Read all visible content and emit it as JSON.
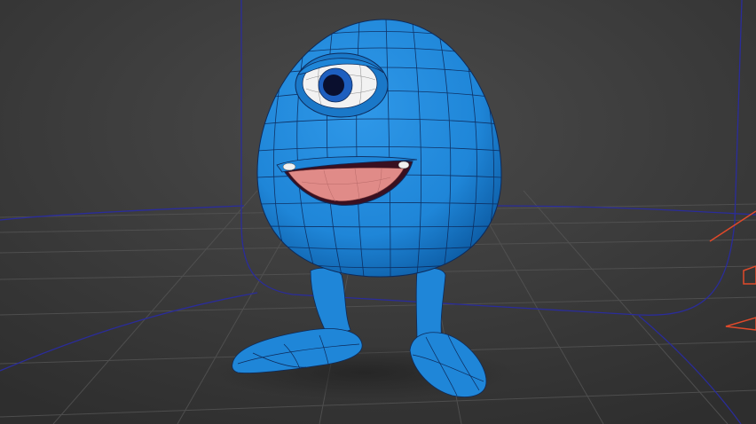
{
  "viewport": {
    "background": "#3a3a3a",
    "floor_color": "#3e3e3e",
    "floor_grid_color": "#505050",
    "wire_color": "#2a2c9a"
  },
  "character": {
    "body_color": "#1f86d8",
    "body_shadow_color": "#0e5fa8",
    "wire_color": "#0d2a5a",
    "eye_white": "#f2f2f2",
    "iris_color": "#1e5fbf",
    "pupil_color": "#0a0f2e",
    "tongue_color": "#e08b88",
    "mouth_color": "#3a1020"
  },
  "gizmo": {
    "color": "#e0492a"
  }
}
